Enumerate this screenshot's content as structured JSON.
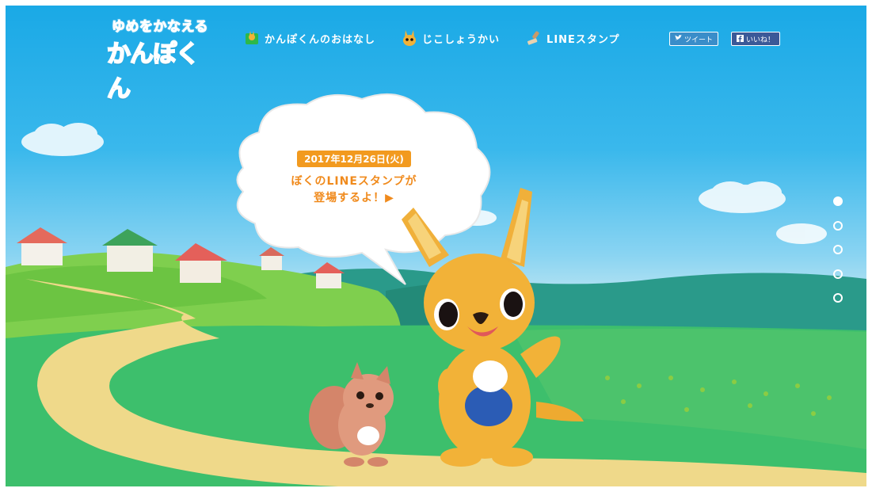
{
  "logo": {
    "tagline": "ゆめをかなえる",
    "name": "かんぽくん"
  },
  "nav": {
    "items": [
      {
        "label": "かんぽくんのおはなし",
        "icon": "book-icon"
      },
      {
        "label": "じこしょうかい",
        "icon": "kanpo-face-icon"
      },
      {
        "label": "LINEスタンプ",
        "icon": "stamp-icon"
      }
    ]
  },
  "social": {
    "tweet_label": "ツイート",
    "like_label": "いいね！"
  },
  "hero": {
    "date": "2017年12月26日(火)",
    "message_line1": "ぼくのLINEスタンプが",
    "message_line2": "登場するよ！▶"
  },
  "slider": {
    "count": 5,
    "active_index": 0
  },
  "colors": {
    "sky": "#1aa9e6",
    "grass": "#3bbf6a",
    "accent_orange": "#f29a1f",
    "logo_blue": "#2f8fd0"
  }
}
